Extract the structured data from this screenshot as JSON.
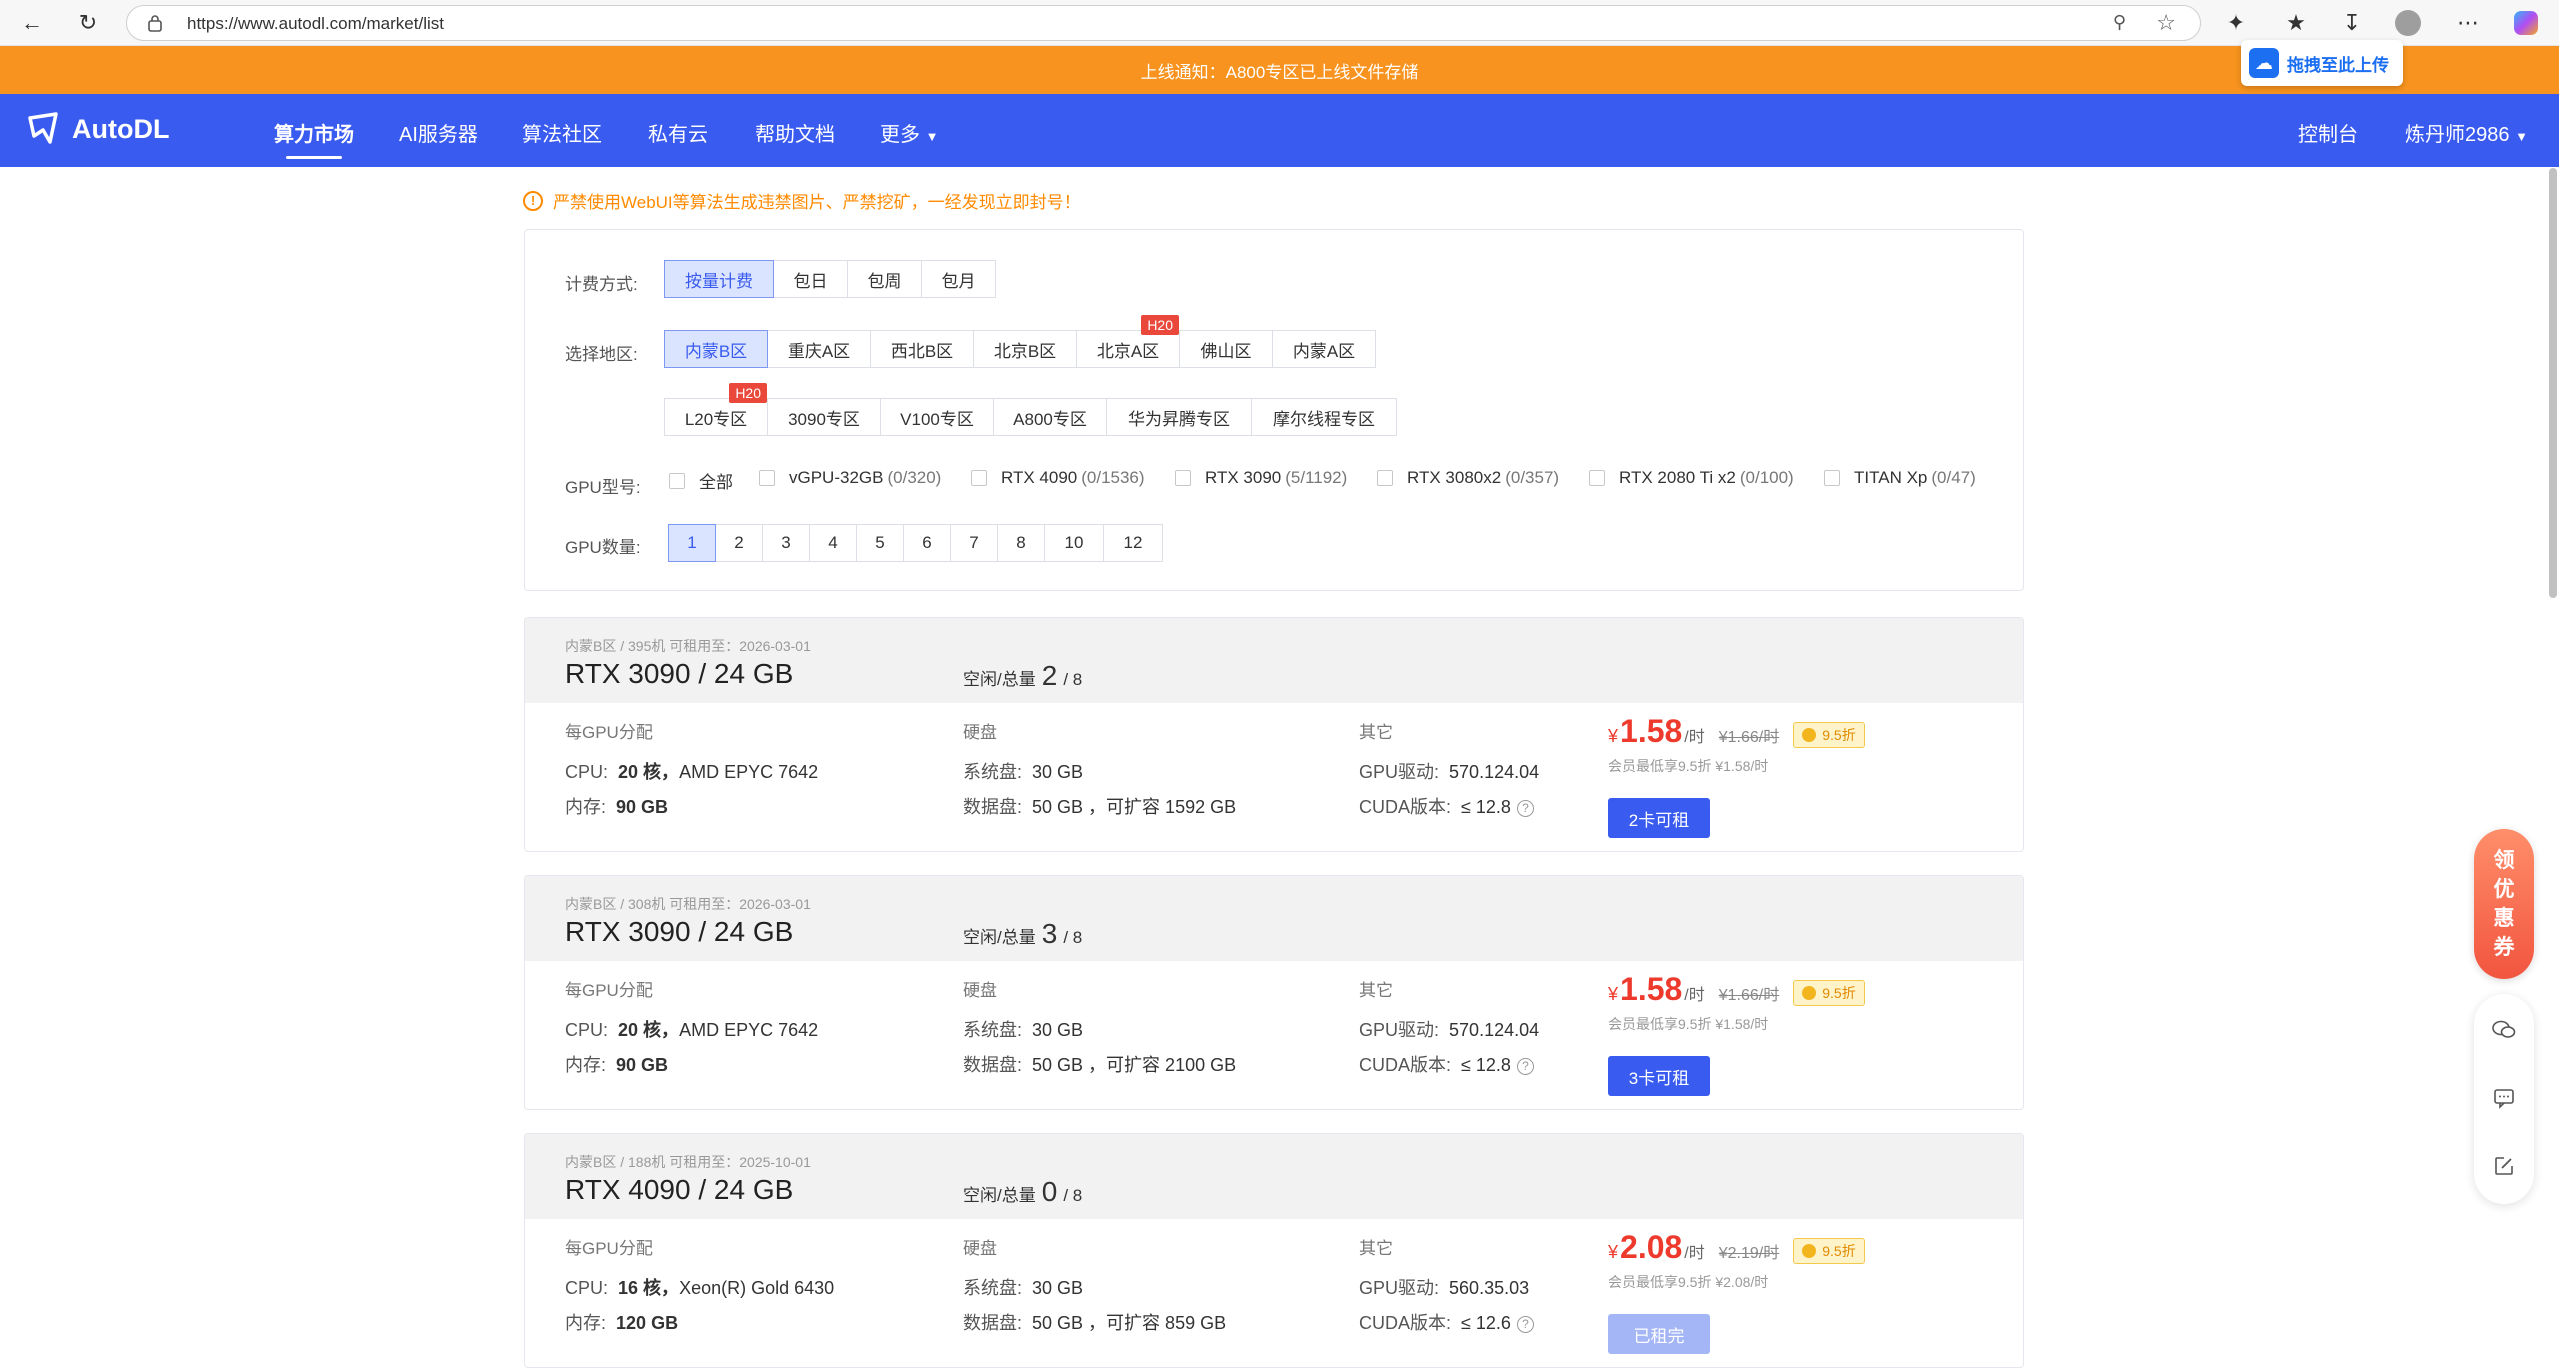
{
  "browser": {
    "url": "https://www.autodl.com/market/list"
  },
  "notice": "上线通知：A800专区已上线文件存储",
  "drag_upload": "拖拽至此上传",
  "nav": {
    "logo": "AutoDL",
    "items": [
      "算力市场",
      "AI服务器",
      "算法社区",
      "私有云",
      "帮助文档",
      "更多"
    ],
    "console": "控制台",
    "user": "炼丹师2986"
  },
  "warning": "严禁使用WebUI等算法生成违禁图片、严禁挖矿，一经发现立即封号！",
  "filters": {
    "billing_label": "计费方式:",
    "billing": [
      "按量计费",
      "包日",
      "包周",
      "包月"
    ],
    "region_label": "选择地区:",
    "regions_row1": [
      "内蒙B区",
      "重庆A区",
      "西北B区",
      "北京B区",
      "北京A区",
      "佛山区",
      "内蒙A区"
    ],
    "regions_row2": [
      "L20专区",
      "3090专区",
      "V100专区",
      "A800专区",
      "华为昇腾专区",
      "摩尔线程专区"
    ],
    "tag": "H20",
    "gpu_label": "GPU型号:",
    "gpus": [
      {
        "name": "全部",
        "count": ""
      },
      {
        "name": "vGPU-32GB",
        "count": "(0/320)"
      },
      {
        "name": "RTX 4090",
        "count": "(0/1536)"
      },
      {
        "name": "RTX 3090",
        "count": "(5/1192)"
      },
      {
        "name": "RTX 3080x2",
        "count": "(0/357)"
      },
      {
        "name": "RTX 2080 Ti x2",
        "count": "(0/100)"
      },
      {
        "name": "TITAN Xp",
        "count": "(0/47)"
      }
    ],
    "count_label": "GPU数量:",
    "counts": [
      "1",
      "2",
      "3",
      "4",
      "5",
      "6",
      "7",
      "8",
      "10",
      "12"
    ]
  },
  "labels": {
    "idle_total": "空闲/总量",
    "per_gpu": "每GPU分配",
    "disk": "硬盘",
    "other": "其它",
    "cpu": "CPU:",
    "mem": "内存:",
    "sys_disk": "系统盘:",
    "data_disk": "数据盘:",
    "gpu_driver": "GPU驱动:",
    "cuda": "CUDA版本:",
    "unit": "/时",
    "currency": "¥"
  },
  "machines": [
    {
      "meta": "内蒙B区 / 395机   可租用至：2026-03-01",
      "title": "RTX 3090 / 24 GB",
      "idle": "2",
      "total": "/ 8",
      "cpu_cores": "20 核，",
      "cpu_model": "AMD EPYC 7642",
      "mem": "90 GB",
      "sys_disk": "30 GB",
      "data_disk": "50 GB ，可扩容 1592 GB",
      "driver": "570.124.04",
      "cuda": "≤ 12.8",
      "price": "1.58",
      "old_price": "¥1.66/时",
      "discount": "9.5折",
      "member": "会员最低享9.5折  ¥1.58/时",
      "button": "2卡可租",
      "disabled": false
    },
    {
      "meta": "内蒙B区 / 308机   可租用至：2026-03-01",
      "title": "RTX 3090 / 24 GB",
      "idle": "3",
      "total": "/ 8",
      "cpu_cores": "20 核，",
      "cpu_model": "AMD EPYC 7642",
      "mem": "90 GB",
      "sys_disk": "30 GB",
      "data_disk": "50 GB ，可扩容 2100 GB",
      "driver": "570.124.04",
      "cuda": "≤ 12.8",
      "price": "1.58",
      "old_price": "¥1.66/时",
      "discount": "9.5折",
      "member": "会员最低享9.5折  ¥1.58/时",
      "button": "3卡可租",
      "disabled": false
    },
    {
      "meta": "内蒙B区 / 188机   可租用至：2025-10-01",
      "title": "RTX 4090 / 24 GB",
      "idle": "0",
      "total": "/ 8",
      "cpu_cores": "16 核，",
      "cpu_model": "Xeon(R) Gold 6430",
      "mem": "120 GB",
      "sys_disk": "30 GB",
      "data_disk": "50 GB ，可扩容 859 GB",
      "driver": "560.35.03",
      "cuda": "≤ 12.6",
      "price": "2.08",
      "old_price": "¥2.19/时",
      "discount": "9.5折",
      "member": "会员最低享9.5折  ¥2.08/时",
      "button": "已租完",
      "disabled": true
    }
  ],
  "coupon": [
    "领",
    "优",
    "惠",
    "券"
  ]
}
